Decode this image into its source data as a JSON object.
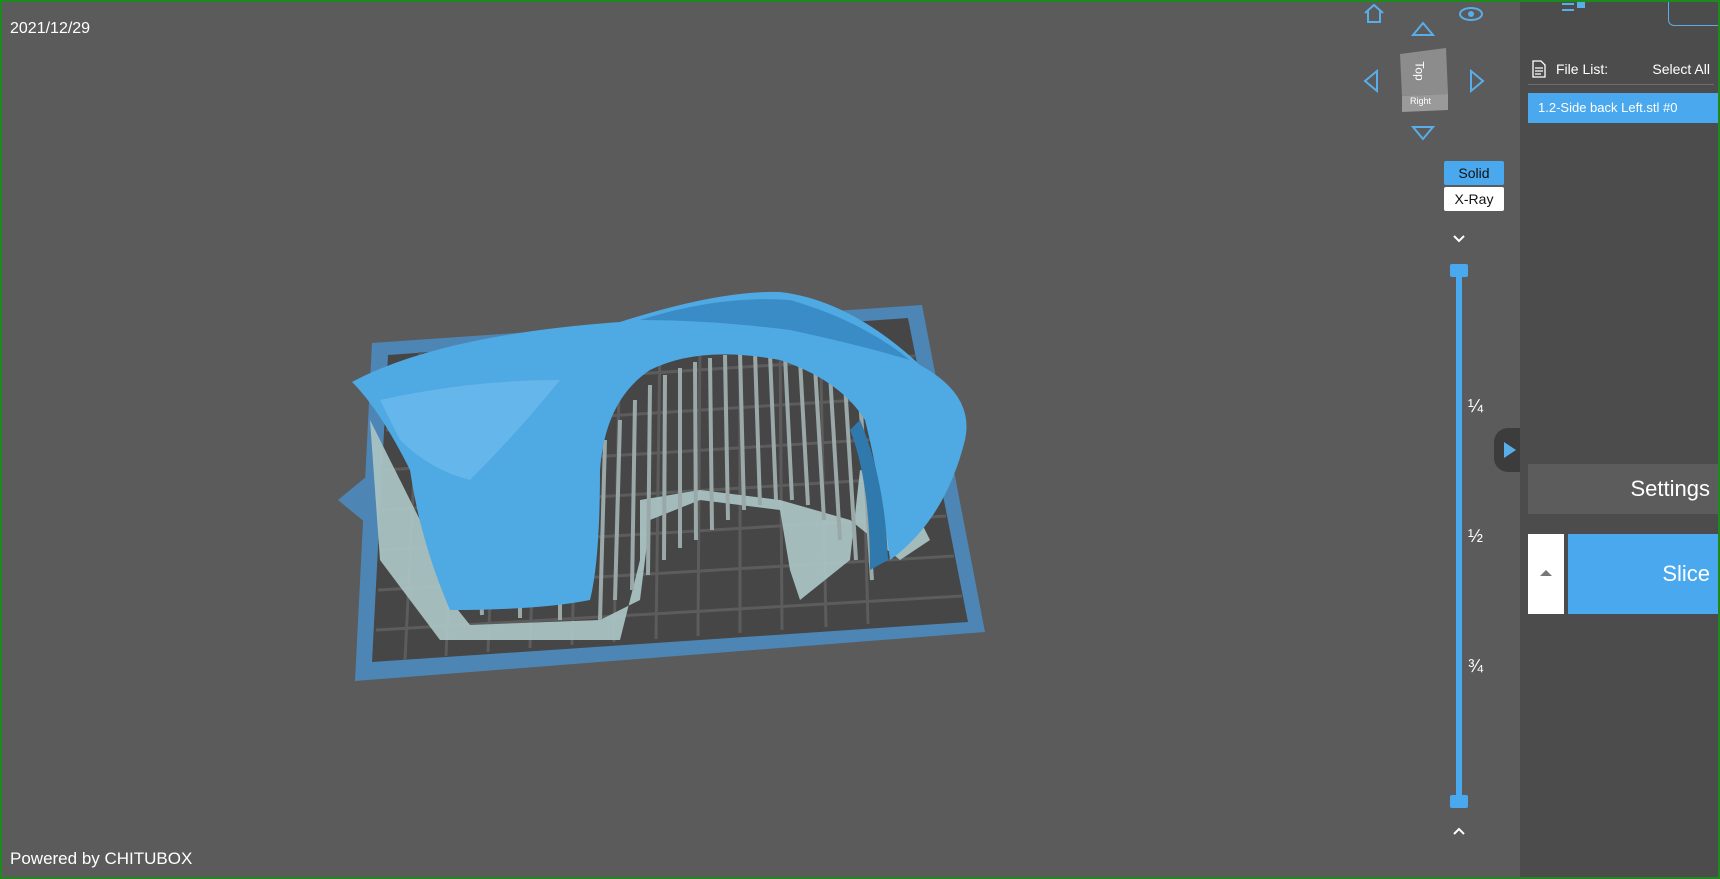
{
  "viewport": {
    "date": "2021/12/29",
    "powered_by": "Powered by CHITUBOX",
    "view_cube": {
      "top_label": "Top",
      "right_label": "Right"
    },
    "view_modes": {
      "solid": "Solid",
      "xray": "X-Ray"
    },
    "layer_slider": {
      "ticks": [
        "¼",
        "½",
        "¾"
      ]
    }
  },
  "panel": {
    "file_list_label": "File List:",
    "select_all_label": "Select All",
    "files": [
      "1.2-Side back Left.stl #0"
    ],
    "settings_label": "Settings",
    "slice_label": "Slice"
  },
  "colors": {
    "accent": "#4aa8ee",
    "viewport_bg": "#5b5b5b",
    "panel_bg": "#4c4c4c",
    "model": "#4fa9e3",
    "supports": "#a9c2c2"
  },
  "icons": {
    "home": "home-icon",
    "eye": "eye-icon",
    "up": "arrow-up-icon",
    "down": "arrow-down-icon",
    "left": "arrow-left-icon",
    "right": "arrow-right-icon",
    "file": "file-icon",
    "collapse": "play-right-icon"
  }
}
